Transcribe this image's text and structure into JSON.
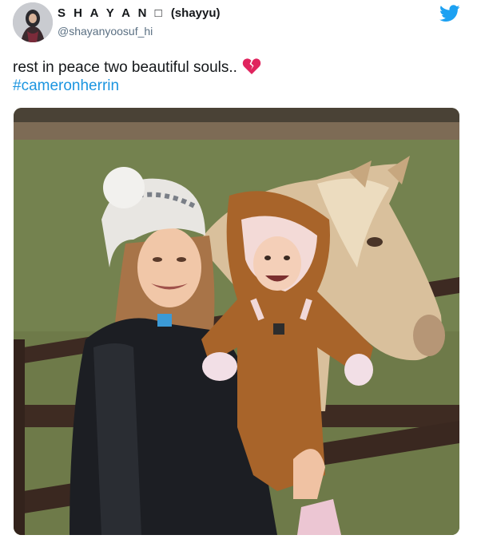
{
  "user": {
    "display_name": "S H A Y A N □",
    "alt_name": "(shayyu)",
    "handle": "@shayanyoosuf_hi",
    "avatar_icon": "profile-photo"
  },
  "tweet": {
    "text": "rest in peace two beautiful souls..",
    "emoji": "broken-heart-icon",
    "hashtag": "#cameronherrin"
  },
  "media": {
    "description_icon": "photo-woman-baby-horse"
  },
  "colors": {
    "twitter_blue": "#1da1f2",
    "link": "#1b95e0",
    "handle_gray": "#5b7083",
    "heart_red": "#e0245e"
  }
}
